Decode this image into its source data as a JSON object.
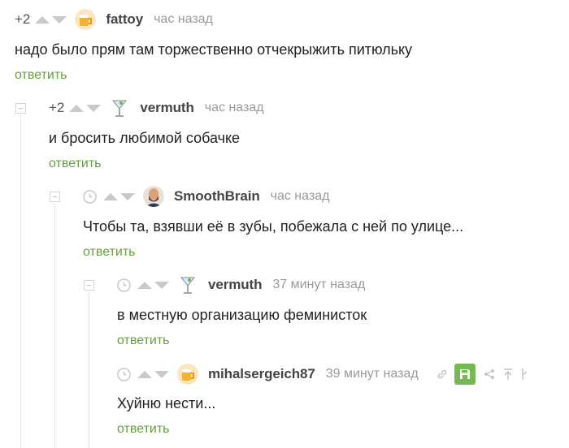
{
  "comments": [
    {
      "rating": "+2",
      "author": "fattoy",
      "time": "час назад",
      "text": "надо было прям там торжественно отчекрыжить питюльку",
      "reply": "ответить",
      "avatar_icon": "beer-mug-avatar"
    },
    {
      "rating": "+2",
      "author": "vermuth",
      "time": "час назад",
      "text": "и бросить любимой собачке",
      "reply": "ответить",
      "avatar_icon": "martini-glass-avatar"
    },
    {
      "author": "SmoothBrain",
      "time": "час назад",
      "text": "Чтобы та, взявши её в зубы, побежала с ней по улице...",
      "reply": "ответить",
      "avatar_icon": "bearded-man-avatar"
    },
    {
      "author": "vermuth",
      "time": "37 минут назад",
      "text": "в местную организацию феминисток",
      "reply": "ответить",
      "avatar_icon": "martini-glass-avatar"
    },
    {
      "author": "mihalsergeich87",
      "time": "39 минут назад",
      "text": "Хуйню нести...",
      "reply": "ответить",
      "avatar_icon": "beer-mug-avatar"
    }
  ],
  "colors": {
    "reply_link": "#63a13a",
    "save_button": "#76b852",
    "arrows": "#c9c9c9"
  }
}
